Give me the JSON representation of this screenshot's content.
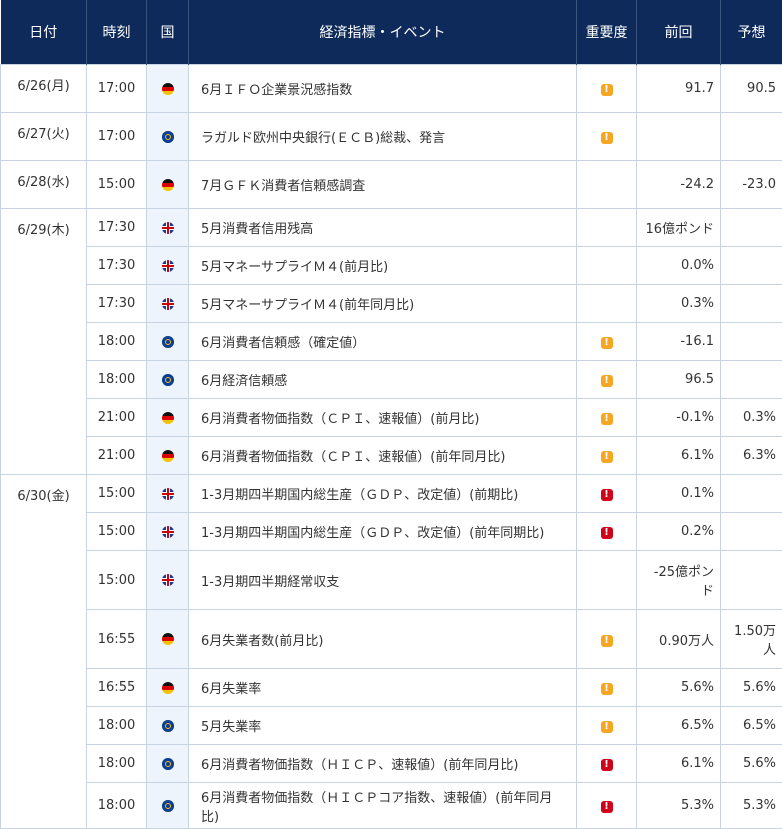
{
  "header": {
    "date": "日付",
    "time": "時刻",
    "country": "国",
    "event": "経済指標・イベント",
    "importance": "重要度",
    "previous": "前回",
    "forecast": "予想"
  },
  "colors": {
    "header_bg": "#0e2a5a",
    "importance_mid": "#f5a623",
    "importance_high": "#d0021b",
    "country_col_bg": "#eef4fb"
  },
  "rows": [
    {
      "date": "6/26(月)",
      "time": "17:00",
      "country": "germany-flag-icon",
      "event": "6月ＩＦＯ企業景況感指数",
      "importance": "medium",
      "importance_mark": "!",
      "previous": "91.7",
      "forecast": "90.5"
    },
    {
      "date": "6/27(火)",
      "time": "17:00",
      "country": "eu-flag-icon",
      "event": "ラガルド欧州中央銀行(ＥＣＢ)総裁、発言",
      "importance": "medium",
      "importance_mark": "!",
      "previous": "",
      "forecast": ""
    },
    {
      "date": "6/28(水)",
      "time": "15:00",
      "country": "germany-flag-icon",
      "event": "7月ＧＦＫ消費者信頼感調査",
      "importance": "",
      "importance_mark": "",
      "previous": "-24.2",
      "forecast": "-23.0"
    },
    {
      "date": "6/29(木)",
      "time": "17:30",
      "country": "uk-flag-icon",
      "event": "5月消費者信用残高",
      "importance": "",
      "importance_mark": "",
      "previous": "16億ポンド",
      "forecast": ""
    },
    {
      "date": "",
      "time": "17:30",
      "country": "uk-flag-icon",
      "event": "5月マネーサプライＭ４(前月比)",
      "importance": "",
      "importance_mark": "",
      "previous": "0.0%",
      "forecast": ""
    },
    {
      "date": "",
      "time": "17:30",
      "country": "uk-flag-icon",
      "event": "5月マネーサプライＭ４(前年同月比)",
      "importance": "",
      "importance_mark": "",
      "previous": "0.3%",
      "forecast": ""
    },
    {
      "date": "",
      "time": "18:00",
      "country": "eu-flag-icon",
      "event": "6月消費者信頼感（確定値）",
      "importance": "medium",
      "importance_mark": "!",
      "previous": "-16.1",
      "forecast": ""
    },
    {
      "date": "",
      "time": "18:00",
      "country": "eu-flag-icon",
      "event": "6月経済信頼感",
      "importance": "medium",
      "importance_mark": "!",
      "previous": "96.5",
      "forecast": ""
    },
    {
      "date": "",
      "time": "21:00",
      "country": "germany-flag-icon",
      "event": "6月消費者物価指数（ＣＰＩ、速報値）(前月比)",
      "importance": "medium",
      "importance_mark": "!",
      "previous": "-0.1%",
      "forecast": "0.3%"
    },
    {
      "date": "",
      "time": "21:00",
      "country": "germany-flag-icon",
      "event": "6月消費者物価指数（ＣＰＩ、速報値）(前年同月比)",
      "importance": "medium",
      "importance_mark": "!",
      "previous": "6.1%",
      "forecast": "6.3%"
    },
    {
      "date": "6/30(金)",
      "time": "15:00",
      "country": "uk-flag-icon",
      "event": "1-3月期四半期国内総生産（ＧＤＰ、改定値）(前期比)",
      "importance": "high",
      "importance_mark": "!",
      "previous": "0.1%",
      "forecast": ""
    },
    {
      "date": "",
      "time": "15:00",
      "country": "uk-flag-icon",
      "event": "1-3月期四半期国内総生産（ＧＤＰ、改定値）(前年同期比)",
      "importance": "high",
      "importance_mark": "!",
      "previous": "0.2%",
      "forecast": ""
    },
    {
      "date": "",
      "time": "15:00",
      "country": "uk-flag-icon",
      "event": "1-3月期四半期経常収支",
      "importance": "",
      "importance_mark": "",
      "previous": "-25億ポンド",
      "forecast": ""
    },
    {
      "date": "",
      "time": "16:55",
      "country": "germany-flag-icon",
      "event": "6月失業者数(前月比)",
      "importance": "medium",
      "importance_mark": "!",
      "previous": "0.90万人",
      "forecast": "1.50万人"
    },
    {
      "date": "",
      "time": "16:55",
      "country": "germany-flag-icon",
      "event": "6月失業率",
      "importance": "medium",
      "importance_mark": "!",
      "previous": "5.6%",
      "forecast": "5.6%"
    },
    {
      "date": "",
      "time": "18:00",
      "country": "eu-flag-icon",
      "event": "5月失業率",
      "importance": "medium",
      "importance_mark": "!",
      "previous": "6.5%",
      "forecast": "6.5%"
    },
    {
      "date": "",
      "time": "18:00",
      "country": "eu-flag-icon",
      "event": "6月消費者物価指数（ＨＩＣＰ、速報値）(前年同月比)",
      "importance": "high",
      "importance_mark": "!",
      "previous": "6.1%",
      "forecast": "5.6%"
    },
    {
      "date": "",
      "time": "18:00",
      "country": "eu-flag-icon",
      "event": "6月消費者物価指数（ＨＩＣＰコア指数、速報値）(前年同月比)",
      "importance": "high",
      "importance_mark": "!",
      "previous": "5.3%",
      "forecast": "5.3%"
    }
  ]
}
